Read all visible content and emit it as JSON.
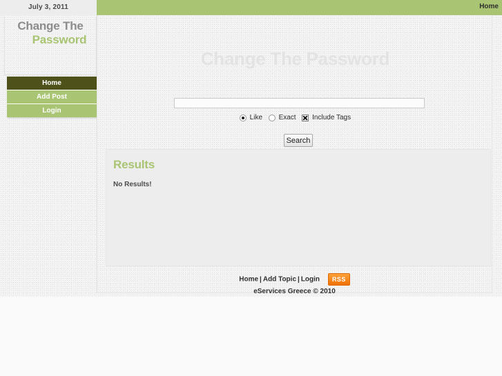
{
  "topbar": {
    "date": "July 3, 2011",
    "home_link": "Home"
  },
  "logo": {
    "line1": "Change The",
    "line2": "Password"
  },
  "nav": {
    "items": [
      {
        "label": "Home",
        "active": true
      },
      {
        "label": "Add Post",
        "active": false
      },
      {
        "label": "Login",
        "active": false
      }
    ]
  },
  "main": {
    "page_title": "Change The Password"
  },
  "search": {
    "value": "",
    "placeholder": "",
    "options": [
      {
        "type": "radio",
        "label": "Like",
        "checked": true
      },
      {
        "type": "radio",
        "label": "Exact",
        "checked": false
      },
      {
        "type": "checkbox",
        "label": "Include Tags",
        "checked": true
      }
    ],
    "button_label": "Search"
  },
  "results": {
    "title": "Results",
    "empty_message": "No Results!"
  },
  "footer": {
    "links": [
      "Home",
      "Add Topic",
      "Login"
    ],
    "separator": "|",
    "rss_label": "RSS",
    "copyright": "eServices Greece © 2010"
  },
  "colors": {
    "green": "#a9c472",
    "dark_olive": "#4e5119",
    "rss_orange": "#f07000",
    "panel_gray": "#ededed",
    "title_gray": "#e3e3e3"
  }
}
